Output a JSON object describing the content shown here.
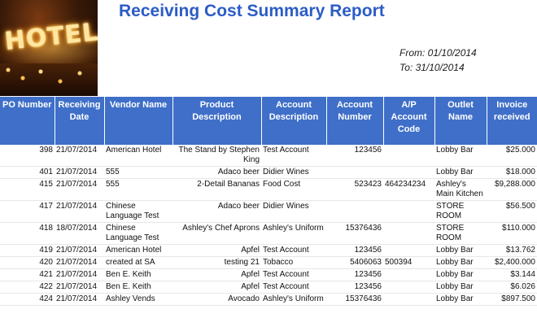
{
  "report": {
    "title": "Receiving Cost Summary Report",
    "from_label": "From: 01/10/2014",
    "to_label": "To: 31/10/2014",
    "hero_sign": "HOTEL"
  },
  "table": {
    "columns": [
      "PO Number",
      "Receiving Date",
      "Vendor Name",
      "Product Description",
      "Account Description",
      "Account Number",
      "A/P Account Code",
      "Outlet Name",
      "Invoice received"
    ],
    "rows": [
      {
        "po": "398",
        "date": "21/07/2014",
        "vendor": "American Hotel",
        "product": "The Stand by Stephen King",
        "account": "Test Account",
        "acct_no": "123456",
        "ap_code": "",
        "outlet": "Lobby Bar",
        "invoice": "$25.000"
      },
      {
        "po": "401",
        "date": "21/07/2014",
        "vendor": "555",
        "product": "Adaco beer",
        "account": "Didier Wines",
        "acct_no": "",
        "ap_code": "",
        "outlet": "Lobby Bar",
        "invoice": "$18.000"
      },
      {
        "po": "415",
        "date": "21/07/2014",
        "vendor": "555",
        "product": "2-Detail Bananas",
        "account": "Food Cost",
        "acct_no": "523423",
        "ap_code": "464234234",
        "outlet": "Ashley's Main Kitchen",
        "invoice": "$9,288.000"
      },
      {
        "po": "417",
        "date": "21/07/2014",
        "vendor": "Chinese Language Test",
        "product": "Adaco beer",
        "account": "Didier Wines",
        "acct_no": "",
        "ap_code": "",
        "outlet": "STORE ROOM",
        "invoice": "$56.500"
      },
      {
        "po": "418",
        "date": "18/07/2014",
        "vendor": "Chinese Language Test",
        "product": "Ashley's Chef Aprons",
        "account": "Ashley's Uniform",
        "acct_no": "15376436",
        "ap_code": "",
        "outlet": "STORE ROOM",
        "invoice": "$110.000"
      },
      {
        "po": "419",
        "date": "21/07/2014",
        "vendor": "American Hotel",
        "product": "Apfel",
        "account": "Test Account",
        "acct_no": "123456",
        "ap_code": "",
        "outlet": "Lobby Bar",
        "invoice": "$13.762"
      },
      {
        "po": "420",
        "date": "21/07/2014",
        "vendor": "created at SA",
        "product": "testing 21",
        "account": "Tobacco",
        "acct_no": "5406063",
        "ap_code": "500394",
        "outlet": "Lobby Bar",
        "invoice": "$2,400.000"
      },
      {
        "po": "421",
        "date": "21/07/2014",
        "vendor": "Ben E. Keith",
        "product": "Apfel",
        "account": "Test Account",
        "acct_no": "123456",
        "ap_code": "",
        "outlet": "Lobby Bar",
        "invoice": "$3.144"
      },
      {
        "po": "422",
        "date": "21/07/2014",
        "vendor": "Ben E. Keith",
        "product": "Apfel",
        "account": "Test Account",
        "acct_no": "123456",
        "ap_code": "",
        "outlet": "Lobby Bar",
        "invoice": "$6.026"
      },
      {
        "po": "424",
        "date": "21/07/2014",
        "vendor": "Ashley Vends",
        "product": "Avocado",
        "account": "Ashley's Uniform",
        "acct_no": "15376436",
        "ap_code": "",
        "outlet": "Lobby Bar",
        "invoice": "$897.500"
      }
    ]
  },
  "colors": {
    "title": "#2c5cc5",
    "header_bg": "#3f6fc8",
    "header_text": "#ffffff"
  }
}
